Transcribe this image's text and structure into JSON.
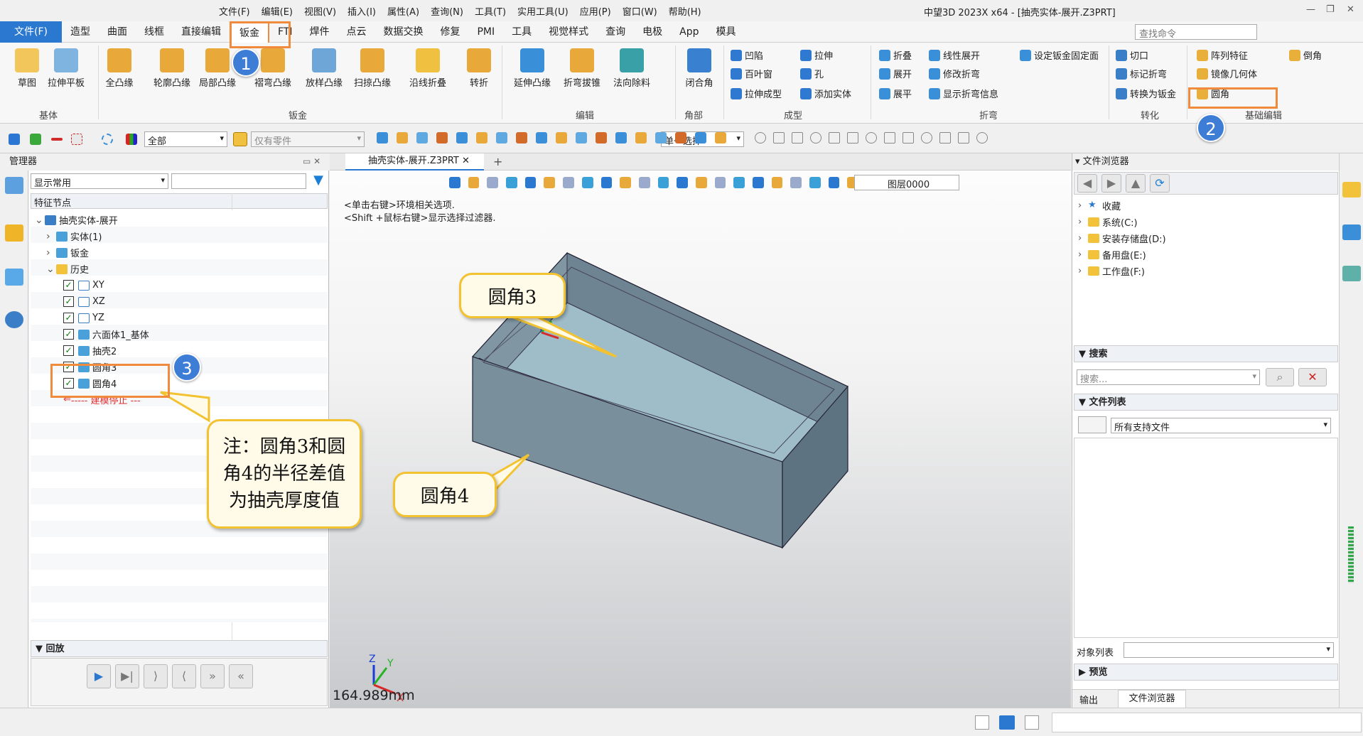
{
  "menu": [
    "文件(F)",
    "编辑(E)",
    "视图(V)",
    "插入(I)",
    "属性(A)",
    "查询(N)",
    "工具(T)",
    "实用工具(U)",
    "应用(P)",
    "窗口(W)",
    "帮助(H)"
  ],
  "window_title": "中望3D 2023X x64 - [抽壳实体-展开.Z3PRT]",
  "tabs": [
    "文件(F)",
    "造型",
    "曲面",
    "线框",
    "直接编辑",
    "钣金",
    "FTI",
    "焊件",
    "点云",
    "数据交换",
    "修复",
    "PMI",
    "工具",
    "视觉样式",
    "查询",
    "电极",
    "App",
    "模具"
  ],
  "search_command": {
    "placeholder": "查找命令"
  },
  "ribbon": {
    "large": [
      "草图",
      "拉伸平板",
      "全凸缘",
      "轮廓凸缘",
      "局部凸缘",
      "褶弯凸缘",
      "放样凸缘",
      "扫掠凸缘",
      "沿线折叠",
      "转折",
      "延伸凸缘",
      "折弯拔锥",
      "法向除料",
      "闭合角"
    ],
    "forming": [
      "凹陷",
      "拉伸",
      "百叶窗",
      "孔",
      "拉伸成型",
      "添加实体"
    ],
    "bend": [
      "折叠",
      "线性展开",
      "设定钣金固定面",
      "展开",
      "修改折弯",
      "展平",
      "显示折弯信息"
    ],
    "convert": [
      "切口",
      "标记折弯",
      "转换为钣金"
    ],
    "basic": [
      "阵列特征",
      "倒角",
      "镜像几何体",
      "圆角"
    ],
    "groups": [
      "基体",
      "钣金",
      "编辑",
      "角部",
      "成型",
      "折弯",
      "转化",
      "基础编辑"
    ]
  },
  "toolbar2": {
    "filter_all": "全部",
    "part_only": "仅有零件",
    "select_mode": "单一选择",
    "layer": "图层0000"
  },
  "manager": {
    "title": "管理器",
    "display": "显示常用",
    "column": "特征节点",
    "tree": [
      {
        "label": "抽壳实体-展开",
        "indent": 0
      },
      {
        "label": "实体(1)",
        "indent": 1
      },
      {
        "label": "钣金",
        "indent": 1
      },
      {
        "label": "历史",
        "indent": 1
      },
      {
        "label": "XY",
        "indent": 2
      },
      {
        "label": "XZ",
        "indent": 2
      },
      {
        "label": "YZ",
        "indent": 2
      },
      {
        "label": "六面体1_基体",
        "indent": 2
      },
      {
        "label": "抽壳2",
        "indent": 2
      },
      {
        "label": "圆角3",
        "indent": 2
      },
      {
        "label": "圆角4",
        "indent": 2
      }
    ],
    "stop": "----- 建模停止 ---",
    "replay": "回放"
  },
  "doc_tab": "抽壳实体-展开.Z3PRT",
  "viewport": {
    "hint1": "<单击右键>环境相关选项.",
    "hint2": "<Shift +鼠标右键>显示选择过滤器.",
    "measure": "164.989mm"
  },
  "callouts": {
    "fillet3": "圆角3",
    "fillet4": "圆角4",
    "note": "注：圆角3和圆角4的半径差值为抽壳厚度值"
  },
  "badges": [
    "1",
    "2",
    "3"
  ],
  "file_browser": {
    "title": "文件浏览器",
    "items": [
      "收藏",
      "系统(C:)",
      "安装存储盘(D:)",
      "备用盘(E:)",
      "工作盘(F:)"
    ],
    "search": "搜索",
    "search_placeholder": "搜索...",
    "file_list": "文件列表",
    "file_filter": "所有支持文件",
    "object_list": "对象列表",
    "preview": "预览",
    "tab_output": "输出",
    "tab_browser": "文件浏览器"
  }
}
